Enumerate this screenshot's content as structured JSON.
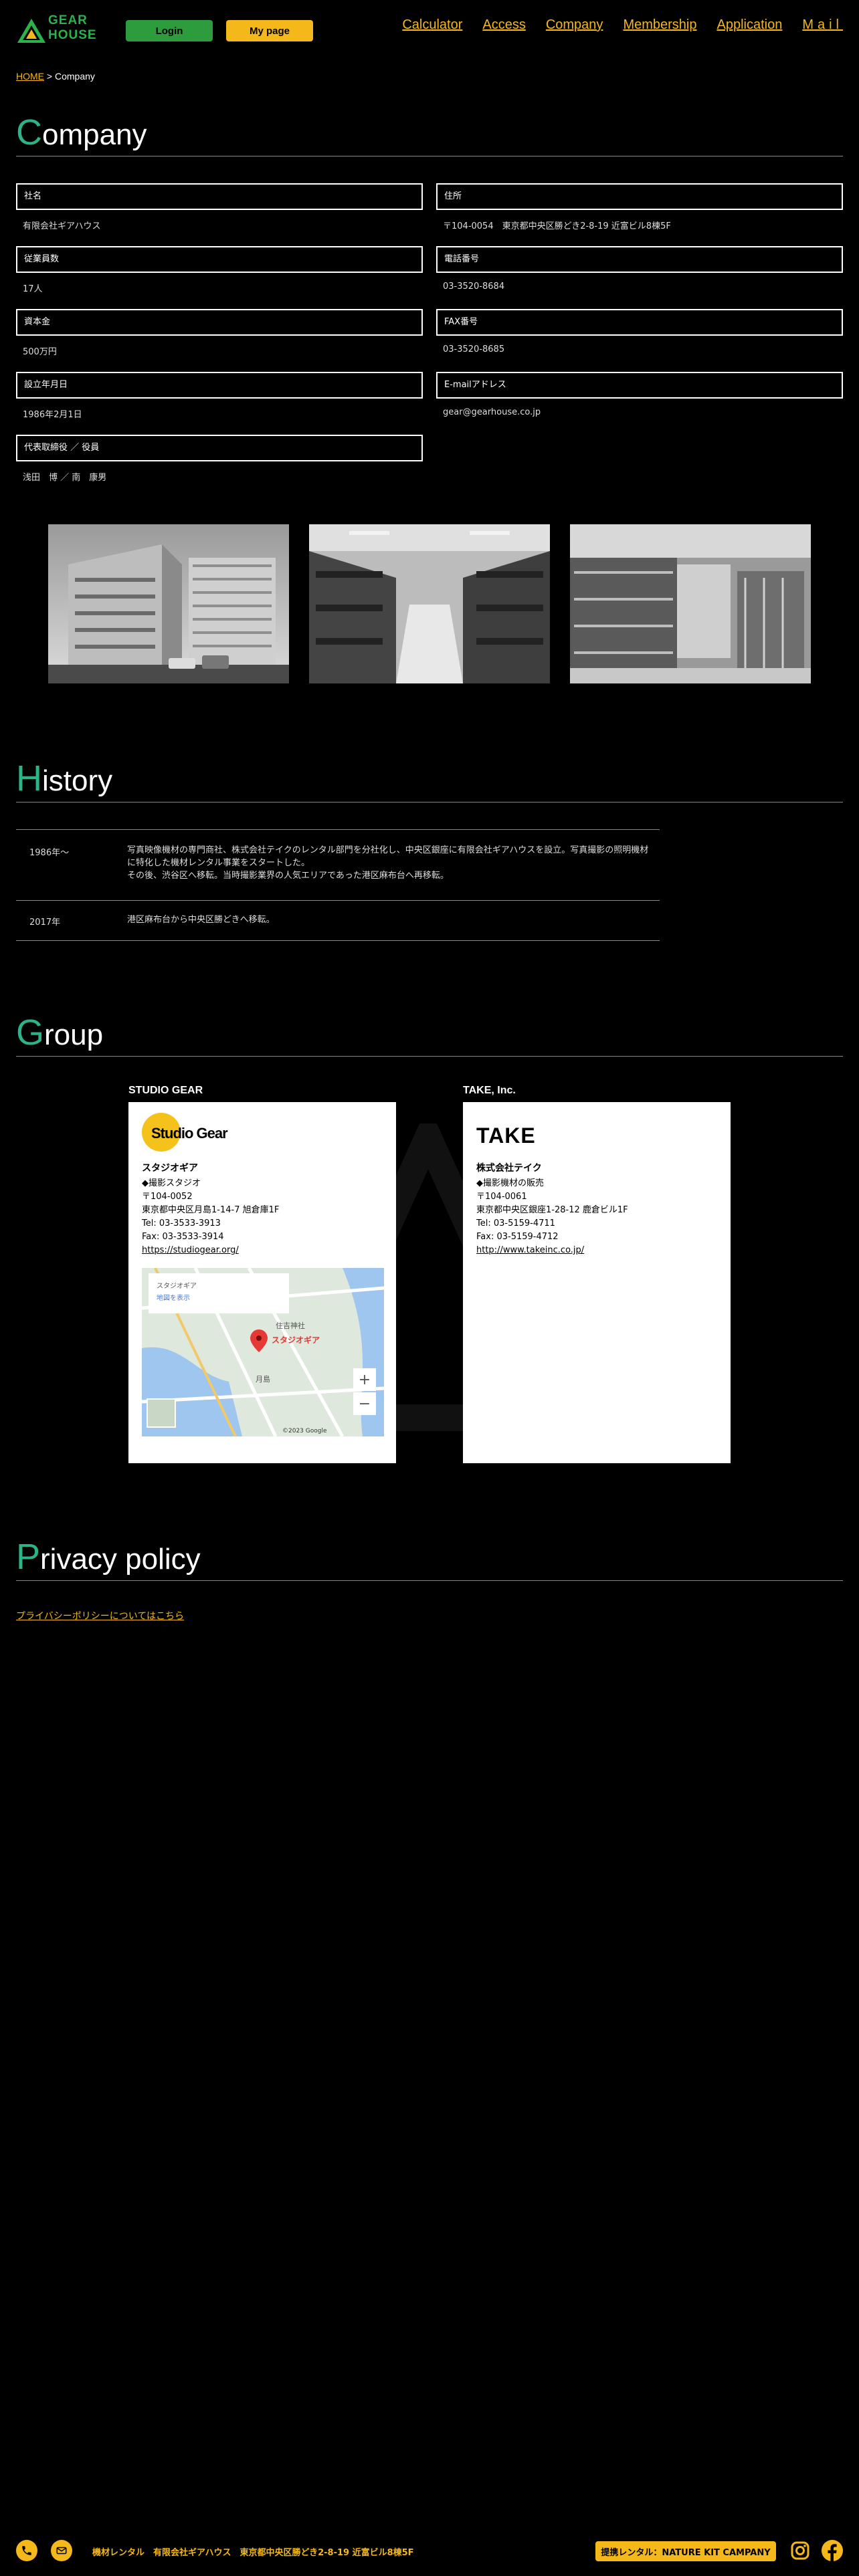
{
  "header": {
    "logo_text_1": "GEAR",
    "logo_text_2": "HOUSE",
    "login_label": "Login",
    "mypage_label": "My page",
    "nav": [
      "Calculator",
      "Access",
      "Company",
      "Membership",
      "Application",
      "Mail"
    ]
  },
  "breadcrumb": {
    "home": "HOME",
    "sep": " > ",
    "current": "Company"
  },
  "company": {
    "title_initial": "C",
    "title_rest": "ompany",
    "fields": [
      {
        "label": "社名",
        "value": "有限会社ギアハウス"
      },
      {
        "label": "住所",
        "value": "〒104-0054　東京都中央区勝どき2-8-19 近富ビル8棟5F"
      },
      {
        "label": "従業員数",
        "value": "17人"
      },
      {
        "label": "電話番号",
        "value": "03-3520-8684"
      },
      {
        "label": "資本金",
        "value": "500万円"
      },
      {
        "label": "FAX番号",
        "value": "03-3520-8685"
      },
      {
        "label": "設立年月日",
        "value": "1986年2月1日"
      },
      {
        "label": "E-mailアドレス",
        "value": "gear@gearhouse.co.jp"
      },
      {
        "label": "代表取締役 ／ 役員",
        "value": "浅田　博 ／ 南　康男"
      }
    ]
  },
  "history": {
    "title_initial": "H",
    "title_rest": "istory",
    "rows": [
      {
        "year": "1986年〜",
        "text": "写真映像機材の専門商社、株式会社テイクのレンタル部門を分社化し、中央区銀座に有限会社ギアハウスを設立。写真撮影の照明機材に特化した機材レンタル事業をスタートした。",
        "text2": "その後、渋谷区へ移転。当時撮影業界の人気エリアであった港区麻布台へ再移転。"
      },
      {
        "year": "2017年",
        "text": "港区麻布台から中央区勝どきへ移転。"
      }
    ]
  },
  "group": {
    "title_initial": "G",
    "title_rest": "roup",
    "companies": [
      {
        "name": "STUDIO GEAR",
        "logo": "Studio Gear",
        "title": "スタジオギア",
        "lines": [
          "◆撮影スタジオ",
          "〒104-0052",
          "東京都中央区月島1-14-7 旭倉庫1F",
          "Tel: 03-3533-3913",
          "Fax: 03-3533-3914"
        ],
        "link": "https://studiogear.org/",
        "map": {
          "pin_label": "スタジオギア",
          "card_line_1": "スタジオギア",
          "card_line_2": "地図を表示",
          "attribution": "©2023 Google",
          "label_1": "住吉神社",
          "label_2": "月島"
        }
      },
      {
        "name": "TAKE, Inc.",
        "logo": "TAKE",
        "title": "株式会社テイク",
        "lines": [
          "◆撮影機材の販売",
          "〒104-0061",
          "東京都中央区銀座1-28-12 鹿倉ビル1F",
          "Tel: 03-5159-4711",
          "Fax: 03-5159-4712"
        ],
        "link": "http://www.takeinc.co.jp/"
      }
    ]
  },
  "privacy": {
    "title_initial": "P",
    "title_rest": "rivacy policy",
    "link": "プライバシーポリシーについてはこちら"
  },
  "footer": {
    "text": "機材レンタル　有限会社ギアハウス　東京都中央区勝どき2-8-19 近富ビル8棟5F",
    "partner_label": "提携レンタル：NATURE KIT CAMPANY"
  },
  "colors": {
    "accent_green": "#2bb389",
    "accent_yellow": "#f4b81a",
    "login_green": "#2c9c3d"
  },
  "icons": [
    "phone-icon",
    "mail-icon",
    "instagram-icon",
    "facebook-icon",
    "logo-triangle-icon"
  ]
}
